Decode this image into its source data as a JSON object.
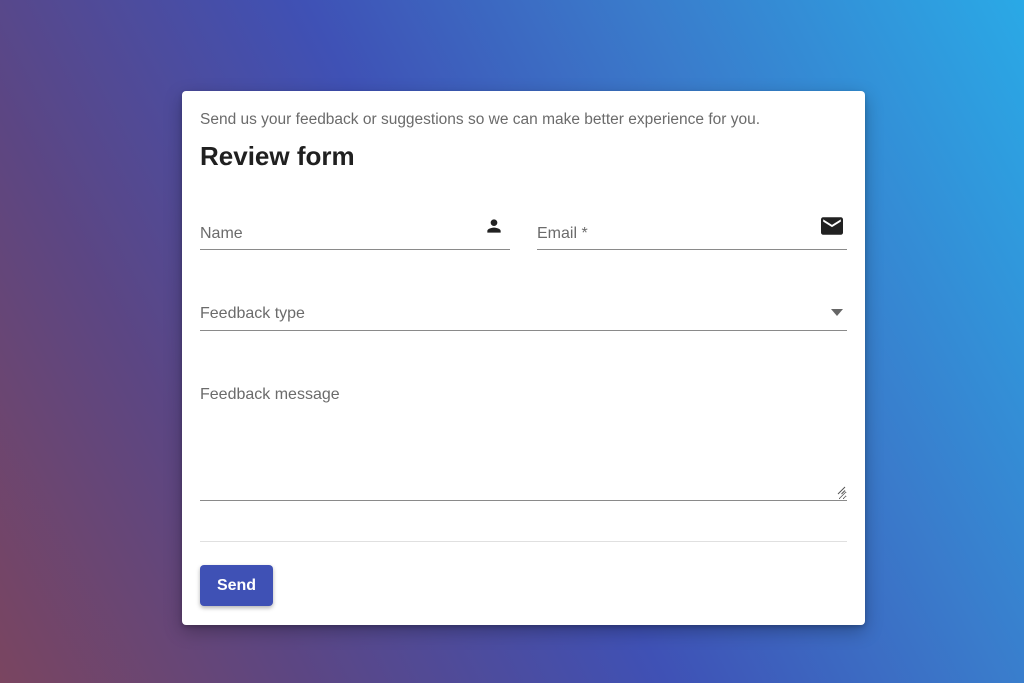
{
  "form": {
    "subtitle": "Send us your feedback or suggestions so we can make better experience for you.",
    "title": "Review form",
    "fields": {
      "name": {
        "label": "Name",
        "value": "",
        "icon": "person-icon"
      },
      "email": {
        "label": "Email *",
        "value": "",
        "icon": "mail-icon"
      },
      "feedback_type": {
        "label": "Feedback type",
        "selected": "",
        "icon": "caret-down-icon"
      },
      "message": {
        "label": "Feedback message",
        "value": ""
      }
    },
    "send_label": "Send"
  },
  "colors": {
    "accent": "#3f51b5",
    "underline": "#8a8a8a",
    "label_text": "#6b6b6b",
    "title_text": "#202020"
  }
}
